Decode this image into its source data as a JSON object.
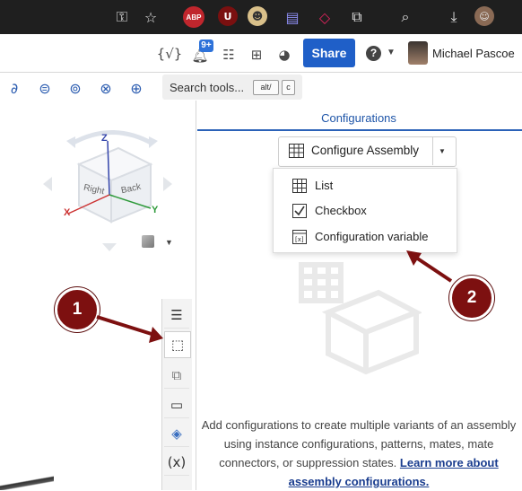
{
  "browser": {
    "icons": [
      "key-icon",
      "star-icon",
      "adblock-plus-icon",
      "ublock-icon",
      "avatar-extension-icon",
      "document-icon",
      "extension-red-icon",
      "puzzle-icon",
      "screen-search-icon",
      "download-icon",
      "profile-icon"
    ],
    "adblock_label": "ABP",
    "ublock_label": "U"
  },
  "header": {
    "notification_count": "9+",
    "share_label": "Share",
    "help_label": "?",
    "user_name": "Michael Pascoe"
  },
  "toolbar": {
    "search_placeholder": "Search tools...",
    "shortcut_1": "alt/",
    "shortcut_2": "c"
  },
  "viewcube": {
    "face_right": "Right",
    "face_back": "Back",
    "axis_x": "X",
    "axis_y": "Y",
    "axis_z": "Z"
  },
  "config_panel": {
    "title": "Configurations",
    "dropdown_label": "Configure Assembly",
    "menu_items": [
      {
        "label": "List",
        "icon": "table-icon"
      },
      {
        "label": "Checkbox",
        "icon": "checkbox-icon"
      },
      {
        "label": "Configuration variable",
        "icon": "variable-icon"
      }
    ],
    "empty_text_1": "Add configurations to create multiple variants of an assembly",
    "empty_text_2": "using instance configurations, patterns, mates, mate",
    "empty_text_3": "connectors, or suppression states.",
    "learn_more_1": "Learn more about",
    "learn_more_2": "assembly configurations."
  },
  "callouts": {
    "one": "1",
    "two": "2"
  },
  "colors": {
    "accent": "#1f5fc8",
    "callout": "#7d1010",
    "link": "#1a3d8f"
  }
}
